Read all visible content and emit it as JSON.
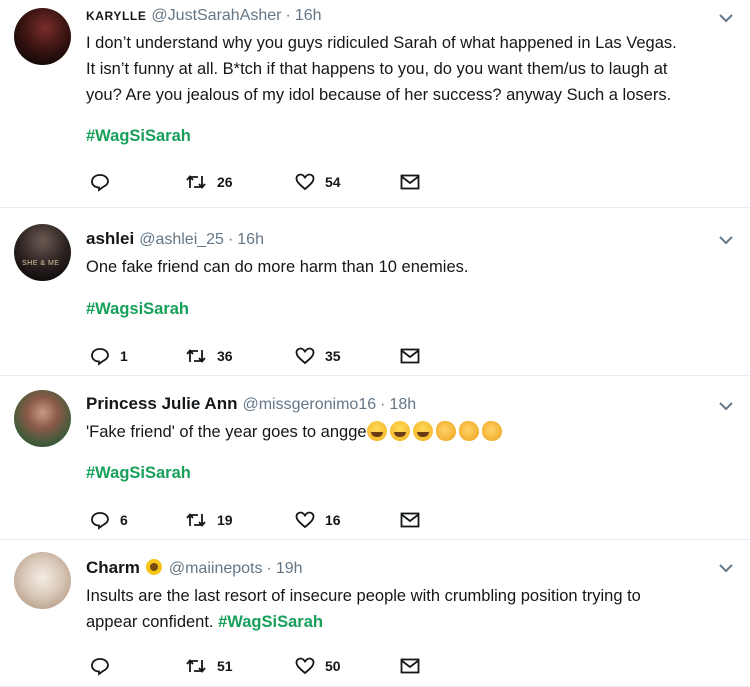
{
  "tweets": [
    {
      "name": "KARYLLE",
      "handle": "@JustSarahAsher",
      "time": "16h",
      "lines": [
        "I don’t understand why you guys ridiculed Sarah of what happened in Las Vegas.",
        "It isn’t funny at all. B*tch if that happens to you, do you want them/us to laugh at",
        "you? Are you jealous of my idol because of her success?  anyway Such a losers."
      ],
      "hashtag": "#WagSiSarah",
      "replies": "",
      "retweets": "26",
      "likes": "54"
    },
    {
      "name": "ashlei",
      "handle": "@ashlei_25",
      "time": "16h",
      "avatar_badge": "SHE & ME",
      "lines": [
        "One fake friend can do more harm than 10 enemies."
      ],
      "hashtag": "#WagsiSarah",
      "replies": "1",
      "retweets": "36",
      "likes": "35"
    },
    {
      "name": "Princess Julie Ann",
      "handle": "@missgeronimo16",
      "time": "18h",
      "text": "'Fake friend' of the year goes to angge",
      "hashtag": "#WagSiSarah",
      "replies": "6",
      "retweets": "19",
      "likes": "16"
    },
    {
      "name": "Charm",
      "handle": "@maiinepots",
      "time": "19h",
      "line1": "Insults are the last resort of insecure people with crumbling position trying to",
      "line2": "appear confident.",
      "hashtag": "#WagSiSarah",
      "replies": "",
      "retweets": "51",
      "likes": "50"
    }
  ],
  "icons": {
    "reply": "reply-icon",
    "retweet": "retweet-icon",
    "like": "heart-icon",
    "dm": "envelope-icon",
    "more": "chevron-down-icon"
  },
  "colors": {
    "hashtag": "#17a05a",
    "muted": "#657786",
    "icon": "#657786"
  }
}
